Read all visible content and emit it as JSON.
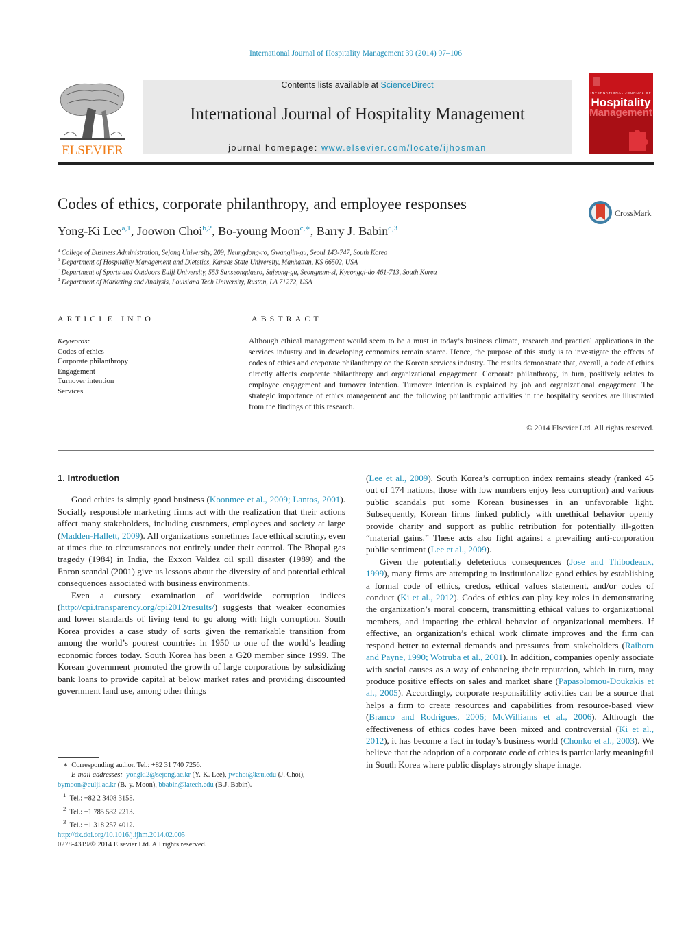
{
  "citation": "International Journal of Hospitality Management 39 (2014) 97–106",
  "header": {
    "contents_prefix": "Contents lists available at ",
    "contents_link": "ScienceDirect",
    "journal_name": "International Journal of Hospitality Management",
    "homepage_prefix": "journal homepage: ",
    "homepage_link": "www.elsevier.com/locate/ijhosman",
    "publisher_logo_text": "ELSEVIER",
    "cover": {
      "line1": "INTERNATIONAL JOURNAL OF",
      "line2": "Hospitality",
      "line3": "Management"
    },
    "colors": {
      "link": "#1f8fb8",
      "elsevier_orange": "#f07d1a",
      "cover_red": "#c8141b"
    }
  },
  "article": {
    "title": "Codes of ethics, corporate philanthropy, and employee responses",
    "crossmark_label": "CrossMark",
    "authors": [
      {
        "name": "Yong-Ki Lee",
        "sup": "a,1",
        "sep": ", "
      },
      {
        "name": "Joowon Choi",
        "sup": "b,2",
        "sep": ", "
      },
      {
        "name": "Bo-young Moon",
        "sup": "c,∗",
        "sep": ", "
      },
      {
        "name": "Barry J. Babin",
        "sup": "d,3",
        "sep": ""
      }
    ],
    "affiliations": [
      {
        "key": "a",
        "text": "College of Business Administration, Sejong University, 209, Neungdong-ro, Gwangjin-gu, Seoul 143-747, South Korea"
      },
      {
        "key": "b",
        "text": "Department of Hospitality Management and Dietetics, Kansas State University, Manhattan, KS 66502, USA"
      },
      {
        "key": "c",
        "text": "Department of Sports and Outdoors Eulji University, 553 Sanseongdaero, Sujeong-gu, Seongnam-si, Kyeonggi-do 461-713, South Korea"
      },
      {
        "key": "d",
        "text": "Department of Marketing and Analysis, Louisiana Tech University, Ruston, LA 71272, USA"
      }
    ]
  },
  "article_info": {
    "heading": "ARTICLE INFO",
    "keywords_label": "Keywords:",
    "keywords": [
      "Codes of ethics",
      "Corporate philanthropy",
      "Engagement",
      "Turnover intention",
      "Services"
    ]
  },
  "abstract": {
    "heading": "ABSTRACT",
    "text": "Although ethical management would seem to be a must in today’s business climate, research and practical applications in the services industry and in developing economies remain scarce. Hence, the purpose of this study is to investigate the effects of codes of ethics and corporate philanthropy on the Korean services industry. The results demonstrate that, overall, a code of ethics directly affects corporate philanthropy and organizational engagement. Corporate philanthropy, in turn, positively relates to employee engagement and turnover intention. Turnover intention is explained by job and organizational engagement. The strategic importance of ethics management and the following philanthropic activities in the hospitality services are illustrated from the findings of this research.",
    "copyright": "© 2014 Elsevier Ltd. All rights reserved."
  },
  "body": {
    "section_heading": "1.  Introduction",
    "left": {
      "p1": [
        {
          "t": "Good ethics is simply good business ("
        },
        {
          "t": "Koonmee et al., 2009; Lantos, 2001",
          "link": true
        },
        {
          "t": "). Socially responsible marketing firms act with the realization that their actions affect many stakeholders, including customers, employees and society at large ("
        },
        {
          "t": "Madden-Hallett, 2009",
          "link": true
        },
        {
          "t": "). All organizations sometimes face ethical scrutiny, even at times due to circumstances not entirely under their control. The Bhopal gas tragedy (1984) in India, the Exxon Valdez oil spill disaster (1989) and the Enron scandal (2001) give us lessons about the diversity of and potential ethical consequences associated with business environments."
        }
      ],
      "p2": [
        {
          "t": "Even a cursory examination of worldwide corruption indices ("
        },
        {
          "t": "http://cpi.transparency.org/cpi2012/results/",
          "link": true
        },
        {
          "t": ") suggests that weaker economies and lower standards of living tend to go along with high corruption. South Korea provides a case study of sorts given the remarkable transition from among the world’s poorest countries in 1950 to one of the world’s leading economic forces today. South Korea has been a G20 member since 1999. The Korean government promoted the growth of large corporations by subsidizing bank loans to provide capital at below market rates and providing discounted government land use, among other things"
        }
      ]
    },
    "right": {
      "p1": [
        {
          "t": "("
        },
        {
          "t": "Lee et al., 2009",
          "link": true
        },
        {
          "t": "). South Korea’s corruption index remains steady (ranked 45 out of 174 nations, those with low numbers enjoy less corruption) and various public scandals put some Korean businesses in an unfavorable light. Subsequently, Korean firms linked publicly with unethical behavior openly provide charity and support as public retribution for potentially ill-gotten “material gains.” These acts also fight against a prevailing anti-corporation public sentiment ("
        },
        {
          "t": "Lee et al., 2009",
          "link": true
        },
        {
          "t": ")."
        }
      ],
      "p2": [
        {
          "t": "Given the potentially deleterious consequences ("
        },
        {
          "t": "Jose and Thibodeaux, 1999",
          "link": true
        },
        {
          "t": "), many firms are attempting to institutionalize good ethics by establishing a formal code of ethics, credos, ethical values statement, and/or codes of conduct ("
        },
        {
          "t": "Ki et al., 2012",
          "link": true
        },
        {
          "t": "). Codes of ethics can play key roles in demonstrating the organization’s moral concern, transmitting ethical values to organizational members, and impacting the ethical behavior of organizational members. If effective, an organization’s ethical work climate improves and the firm can respond better to external demands and pressures from stakeholders ("
        },
        {
          "t": "Raiborn and Payne, 1990; Wotruba et al., 2001",
          "link": true
        },
        {
          "t": "). In addition, companies openly associate with social causes as a way of enhancing their reputation, which in turn, may produce positive effects on sales and market share ("
        },
        {
          "t": "Papasolomou-Doukakis et al., 2005",
          "link": true
        },
        {
          "t": "). Accordingly, corporate responsibility activities can be a source that helps a firm to create resources and capabilities from resource-based view ("
        },
        {
          "t": "Branco and Rodrigues, 2006; McWilliams et al., 2006",
          "link": true
        },
        {
          "t": "). Although the effectiveness of ethics codes have been mixed and controversial ("
        },
        {
          "t": "Ki et al., 2012",
          "link": true
        },
        {
          "t": "), it has become a fact in today’s business world ("
        },
        {
          "t": "Chonko et al., 2003",
          "link": true
        },
        {
          "t": "). We believe that the adoption of a corporate code of ethics is particularly meaningful in South Korea where public displays strongly shape image."
        }
      ]
    }
  },
  "footnotes": {
    "corresponding": "Corresponding author. Tel.: +82 31 740 7256.",
    "corresponding_mark": "∗",
    "email_label": "E-mail addresses:",
    "emails": [
      {
        "addr": "yongki2@sejong.ac.kr",
        "who": " (Y.-K. Lee), "
      },
      {
        "addr": "jwchoi@ksu.edu",
        "who": " (J. Choi), "
      },
      {
        "addr": "bymoon@eulji.ac.kr",
        "who": " (B.-y. Moon), "
      },
      {
        "addr": "bbabin@latech.edu",
        "who": " (B.J. Babin)."
      }
    ],
    "tel": [
      {
        "mark": "1",
        "text": "Tel.: +82 2 3408 3158."
      },
      {
        "mark": "2",
        "text": "Tel.: +1 785 532 2213."
      },
      {
        "mark": "3",
        "text": "Tel.: +1 318 257 4012."
      }
    ],
    "doi": "http://dx.doi.org/10.1016/j.ijhm.2014.02.005",
    "issn_line": "0278-4319/© 2014 Elsevier Ltd. All rights reserved."
  }
}
